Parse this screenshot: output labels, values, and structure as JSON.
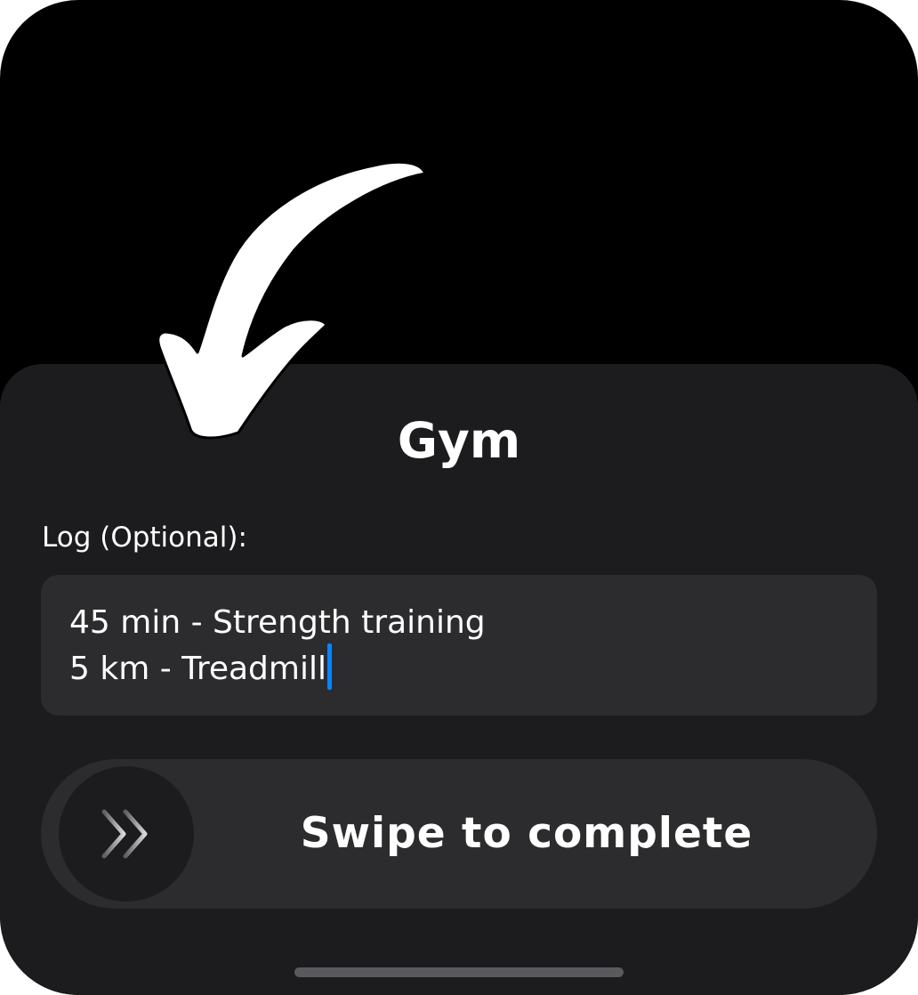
{
  "sheet": {
    "title": "Gym",
    "log_label": "Log (Optional):",
    "log_lines": [
      "45 min - Strength training",
      "5 km - Treadmill"
    ]
  },
  "swipe": {
    "label": "Swipe to complete",
    "icon": "double-chevron-right-icon"
  },
  "annotation": {
    "icon": "curved-arrow-icon",
    "color": "#ffffff"
  },
  "colors": {
    "background": "#000000",
    "sheet": "#1c1c1e",
    "field": "#2c2c2e",
    "caret": "#0a84ff",
    "text": "#ffffff"
  }
}
